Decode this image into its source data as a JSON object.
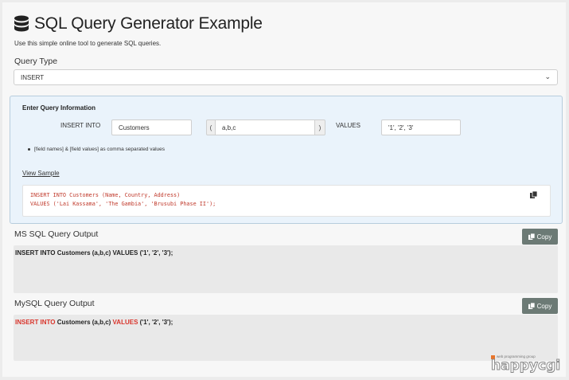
{
  "header": {
    "title": "SQL Query Generator Example",
    "subtitle": "Use this simple online tool to generate SQL queries."
  },
  "query_type": {
    "label": "Query Type",
    "selected": "INSERT"
  },
  "query_info": {
    "title": "Enter Query Information",
    "insert_label": "INSERT INTO",
    "table_value": "Customers",
    "open_paren": "(",
    "fields_value": "a,b,c",
    "close_paren": ")",
    "values_label": "VALUES",
    "values_value": "'1', '2', '3'",
    "note": "[field names] & [field values] as comma separated values",
    "view_sample": "View Sample",
    "sample_line1": "INSERT INTO Customers (Name, Country, Address)",
    "sample_line2": "VALUES ('Lai Kassama', 'The Gambia', 'Brusubi Phase II');"
  },
  "mssql": {
    "label": "MS SQL Query Output",
    "copy_label": "Copy",
    "output": "INSERT INTO Customers (a,b,c) VALUES ('1', '2', '3');"
  },
  "mysql": {
    "label": "MySQL Query Output",
    "copy_label": "Copy",
    "kw_insert": "INSERT INTO",
    "table_part": " Customers (a,b,c) ",
    "kw_values": "VALUES",
    "values_part": " ('1', '2', '3');"
  },
  "brand": {
    "tagline": "web programming group",
    "name": "happycgi"
  },
  "colors": {
    "keyword": "#d9342b",
    "copy_button": "#6c7a75",
    "info_bg": "#eaf3fb"
  }
}
